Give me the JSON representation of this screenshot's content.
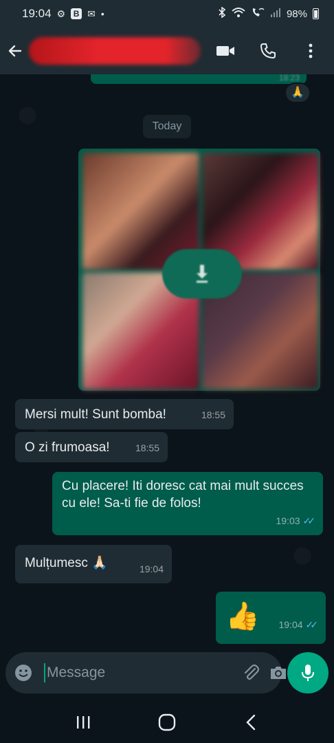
{
  "status_bar": {
    "time": "19:04",
    "battery": "98%",
    "icons": [
      "data-saver-icon",
      "b-app-icon",
      "mail-icon",
      "dot-icon",
      "bluetooth-icon",
      "wifi-icon",
      "wifi-call-icon",
      "signal-icon",
      "battery-icon"
    ]
  },
  "header": {
    "contact_name": "",
    "icons": [
      "back-arrow-icon",
      "video-call-icon",
      "phone-call-icon",
      "more-vert-icon"
    ]
  },
  "chat": {
    "previous_message": {
      "time": "18:23",
      "reaction": "🙏"
    },
    "date_chip": "Today",
    "media_message": {
      "type": "image-album",
      "count_visible": 4,
      "icon": "download-icon"
    },
    "messages": [
      {
        "direction": "incoming",
        "text": "Mersi mult! Sunt bomba!",
        "time": "18:55"
      },
      {
        "direction": "incoming",
        "text": "O zi frumoasa!",
        "time": "18:55"
      },
      {
        "direction": "outgoing",
        "text": "Cu placere! Iti doresc cat mai mult succes cu ele! Sa-ti fie de folos!",
        "time": "19:03",
        "status": "read"
      },
      {
        "direction": "incoming",
        "text": "Mulțumesc 🙏🏻",
        "time": "19:04"
      },
      {
        "direction": "outgoing",
        "text": "👍",
        "time": "19:04",
        "status": "read"
      }
    ]
  },
  "input": {
    "placeholder": "Message",
    "icons": [
      "emoji-icon",
      "attach-icon",
      "camera-icon",
      "mic-icon"
    ]
  },
  "nav_bar": {
    "icons": [
      "recent-apps-icon",
      "home-icon",
      "back-icon"
    ]
  },
  "colors": {
    "background": "#0b141a",
    "header": "#1f2c34",
    "incoming_bubble": "#202c33",
    "outgoing_bubble": "#005c4b",
    "accent": "#00a884",
    "read_check": "#53bdeb"
  }
}
